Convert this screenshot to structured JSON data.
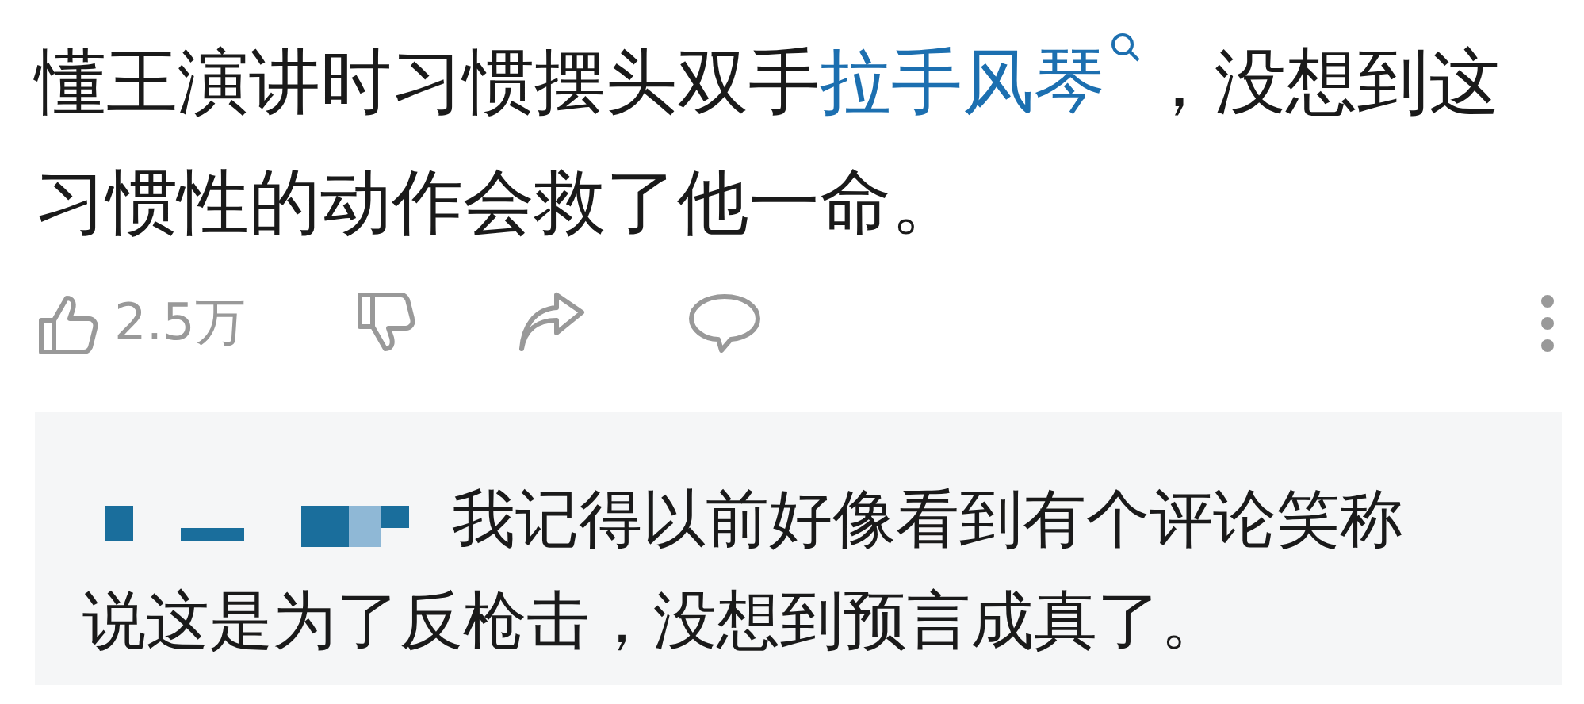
{
  "post": {
    "text_before": "懂王演讲时习惯摆头双手",
    "link": "拉手风琴",
    "text_after": "，没想到这习惯性的动作会救了他一命。"
  },
  "actions": {
    "like_count": "2.5万"
  },
  "reply": {
    "lines": [
      "我记得以前好像看到有个评论笑称",
      "说这是为了反枪击，没想到预言成真了。"
    ]
  }
}
